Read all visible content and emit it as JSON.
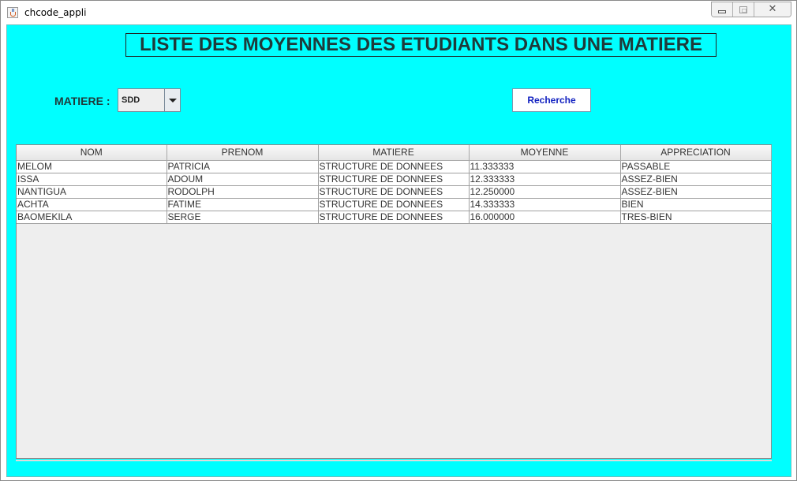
{
  "window": {
    "title": "chcode_appli",
    "close_glyph": "✕"
  },
  "page_title": "LISTE DES MOYENNES DES ETUDIANTS DANS UNE MATIERE",
  "form": {
    "matiere_label": "MATIERE :",
    "matiere_selected": "SDD",
    "search_label": "Recherche"
  },
  "table": {
    "columns": [
      "NOM",
      "PRENOM",
      "MATIERE",
      "MOYENNE",
      "APPRECIATION"
    ],
    "rows": [
      [
        "MELOM",
        "PATRICIA",
        "STRUCTURE DE DONNEES",
        "11.333333",
        "PASSABLE"
      ],
      [
        "ISSA",
        "ADOUM",
        "STRUCTURE DE DONNEES",
        "12.333333",
        "ASSEZ-BIEN"
      ],
      [
        "NANTIGUA",
        "RODOLPH",
        "STRUCTURE DE DONNEES",
        "12.250000",
        "ASSEZ-BIEN"
      ],
      [
        "ACHTA",
        "FATIME",
        "STRUCTURE DE DONNEES",
        "14.333333",
        "BIEN"
      ],
      [
        "BAOMEKILA",
        "SERGE",
        "STRUCTURE DE DONNEES",
        "16.000000",
        "TRES-BIEN"
      ]
    ]
  },
  "colors": {
    "background": "#00ffff",
    "title_text": "#1f3a3a",
    "button_text": "#1020c0"
  },
  "icons": {
    "app": "java-cup-icon",
    "minimize": "minimize-icon",
    "maximize": "maximize-icon",
    "close": "close-icon",
    "dropdown": "chevron-down-icon"
  }
}
